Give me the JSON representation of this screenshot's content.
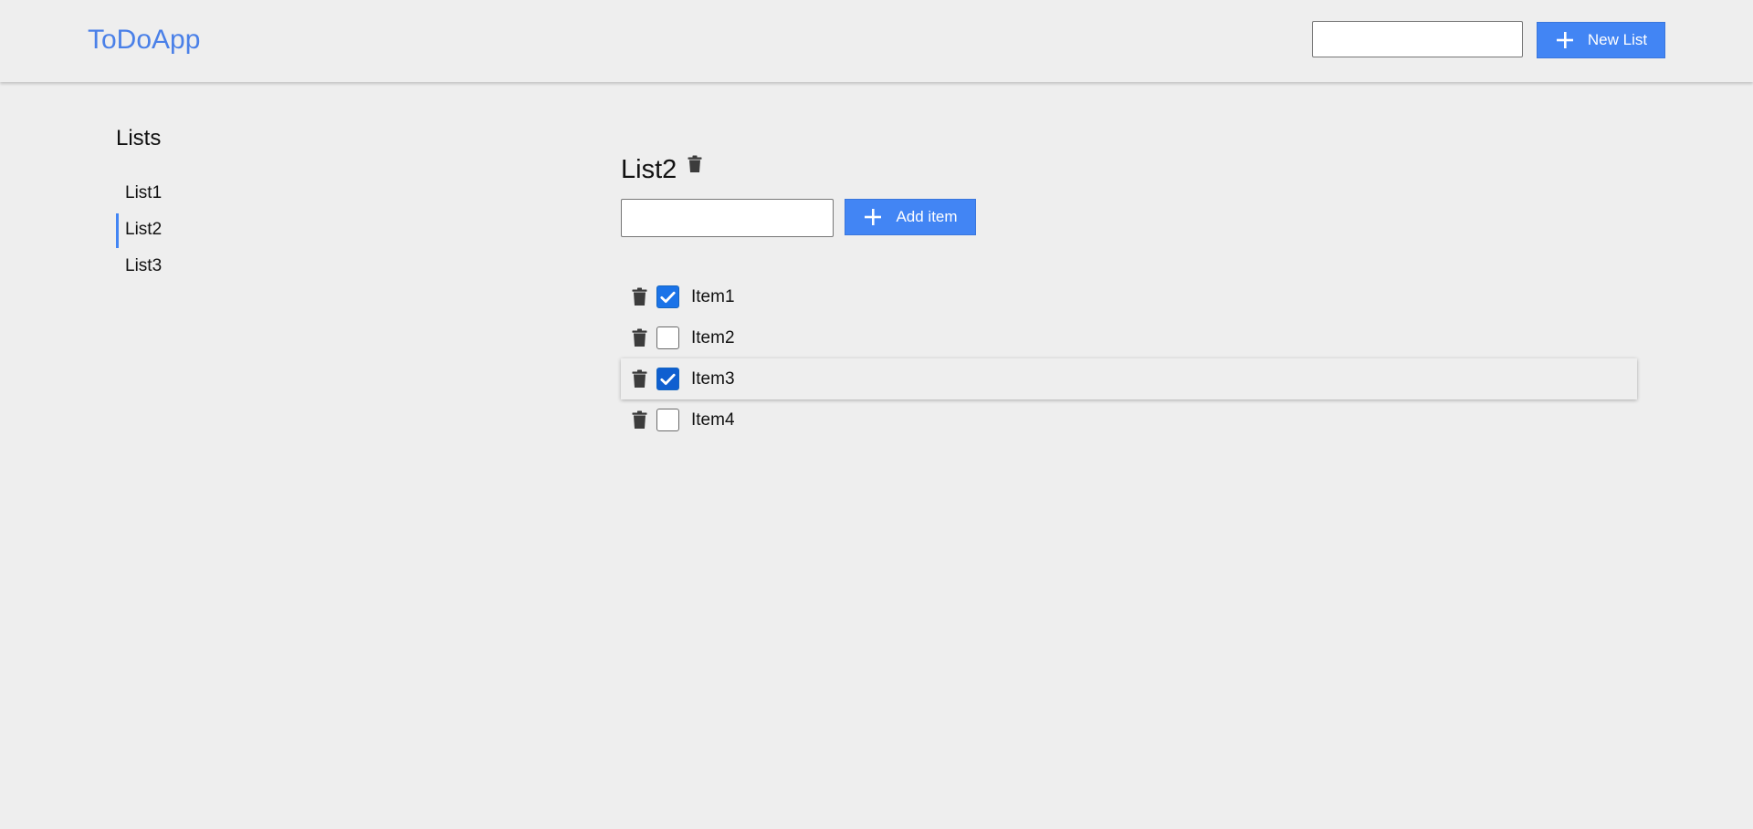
{
  "header": {
    "brand": "ToDoApp",
    "new_list_input_value": "",
    "new_list_button_label": "New List",
    "accent_color": "#4285f4",
    "brand_color": "#4a80e8"
  },
  "sidebar": {
    "title": "Lists",
    "items": [
      {
        "label": "List1",
        "active": false
      },
      {
        "label": "List2",
        "active": true
      },
      {
        "label": "List3",
        "active": false
      }
    ]
  },
  "main": {
    "list_title": "List2",
    "add_item_input_value": "",
    "add_item_button_label": "Add item",
    "items": [
      {
        "label": "Item1",
        "checked": true
      },
      {
        "label": "Item2",
        "checked": false
      },
      {
        "label": "Item3",
        "checked": true
      },
      {
        "label": "Item4",
        "checked": false
      }
    ]
  },
  "icons": {
    "trash": "trash-icon",
    "plus": "plus-icon",
    "check": "check-icon"
  }
}
